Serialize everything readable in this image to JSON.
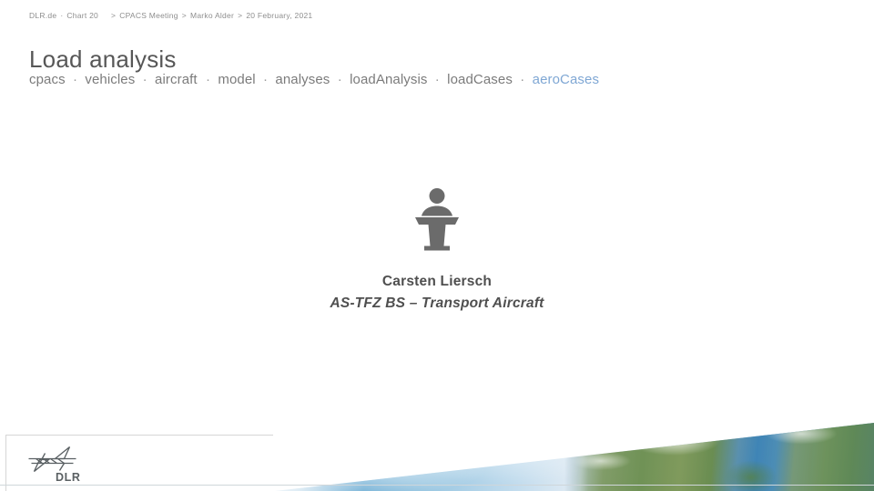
{
  "header": {
    "site": "DLR.de",
    "separator_dot": "·",
    "chart_label": "Chart 20",
    "chevron": ">",
    "crumbs": [
      "CPACS Meeting",
      "Marko Alder",
      "20 February, 2021"
    ]
  },
  "title": "Load analysis",
  "xpath": {
    "separator": "·",
    "nodes": [
      {
        "label": "cpacs",
        "accent": false
      },
      {
        "label": "vehicles",
        "accent": false
      },
      {
        "label": "aircraft",
        "accent": false
      },
      {
        "label": "model",
        "accent": false
      },
      {
        "label": "analyses",
        "accent": false
      },
      {
        "label": "loadAnalysis",
        "accent": false
      },
      {
        "label": "loadCases",
        "accent": false
      },
      {
        "label": "aeroCases",
        "accent": true
      }
    ],
    "accent_color": "#7fa7d4"
  },
  "presenter": {
    "icon": "speaker-at-podium-icon",
    "name": "Carsten Liersch",
    "department": "AS-TFZ BS – Transport Aircraft"
  },
  "footer": {
    "logo_text": "DLR",
    "logo_name": "dlr-logo",
    "background_image": "earth-from-space-photo"
  },
  "colors": {
    "title_gray": "#575757",
    "body_gray": "#7b7b7b",
    "header_gray": "#8e8e8e",
    "accent_blue": "#7fa7d4",
    "logo_gray": "#5a6063",
    "icon_gray": "#6b6b6b"
  }
}
